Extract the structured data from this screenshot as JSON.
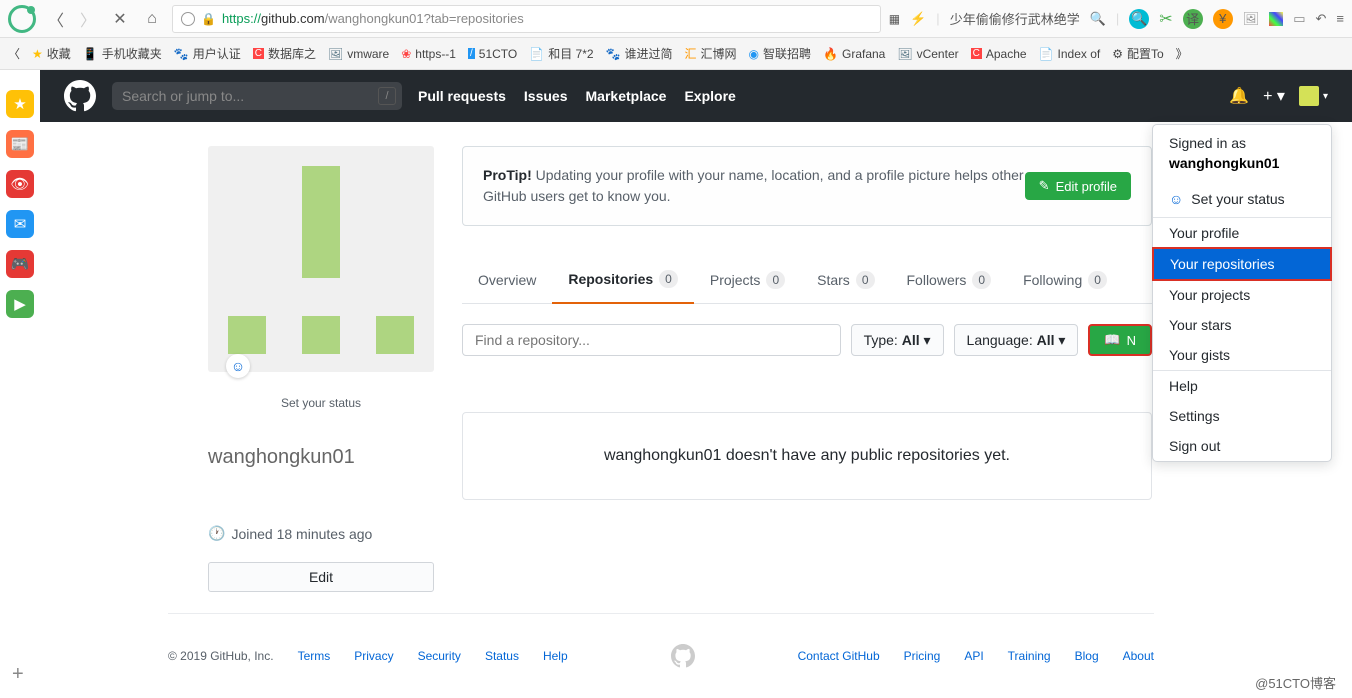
{
  "browser": {
    "url_prefix": "https://",
    "url_domain": "github.com",
    "url_path": "/wanghongkun01?tab=repositories",
    "search_placeholder": "少年偷偷修行武林绝学"
  },
  "bookmarks": [
    {
      "label": "收藏"
    },
    {
      "label": "手机收藏夹"
    },
    {
      "label": "用户认证"
    },
    {
      "label": "数据库之"
    },
    {
      "label": "vmware"
    },
    {
      "label": "https--1"
    },
    {
      "label": "51CTO"
    },
    {
      "label": "和目 7*2"
    },
    {
      "label": "谁进过简"
    },
    {
      "label": "汇博网"
    },
    {
      "label": "智联招聘"
    },
    {
      "label": "Grafana"
    },
    {
      "label": "vCenter"
    },
    {
      "label": "Apache"
    },
    {
      "label": "Index of"
    },
    {
      "label": "配置To"
    }
  ],
  "gh_header": {
    "search_placeholder": "Search or jump to...",
    "nav": [
      "Pull requests",
      "Issues",
      "Marketplace",
      "Explore"
    ]
  },
  "profile": {
    "set_status": "Set your status",
    "username": "wanghongkun01",
    "joined": "Joined 18 minutes ago",
    "edit": "Edit"
  },
  "protip": {
    "bold": "ProTip!",
    "text": " Updating your profile with your name, location, and a profile picture helps other GitHub users get to know you.",
    "button": "Edit profile"
  },
  "tabs": [
    {
      "label": "Overview",
      "count": null
    },
    {
      "label": "Repositories",
      "count": "0",
      "active": true
    },
    {
      "label": "Projects",
      "count": "0"
    },
    {
      "label": "Stars",
      "count": "0"
    },
    {
      "label": "Followers",
      "count": "0"
    },
    {
      "label": "Following",
      "count": "0"
    }
  ],
  "filters": {
    "find_placeholder": "Find a repository...",
    "type_label": "Type: ",
    "type_value": "All",
    "lang_label": "Language: ",
    "lang_value": "All",
    "new_label": "N"
  },
  "empty": "wanghongkun01 doesn't have any public repositories yet.",
  "dropdown": {
    "signed_in": "Signed in as",
    "user": "wanghongkun01",
    "set_status": "Set your status",
    "items1": [
      "Your profile",
      "Your repositories",
      "Your projects",
      "Your stars",
      "Your gists"
    ],
    "items2": [
      "Help",
      "Settings",
      "Sign out"
    ]
  },
  "footer": {
    "copy": "© 2019 GitHub, Inc.",
    "left": [
      "Terms",
      "Privacy",
      "Security",
      "Status",
      "Help"
    ],
    "right": [
      "Contact GitHub",
      "Pricing",
      "API",
      "Training",
      "Blog",
      "About"
    ]
  },
  "watermark": "@51CTO博客"
}
